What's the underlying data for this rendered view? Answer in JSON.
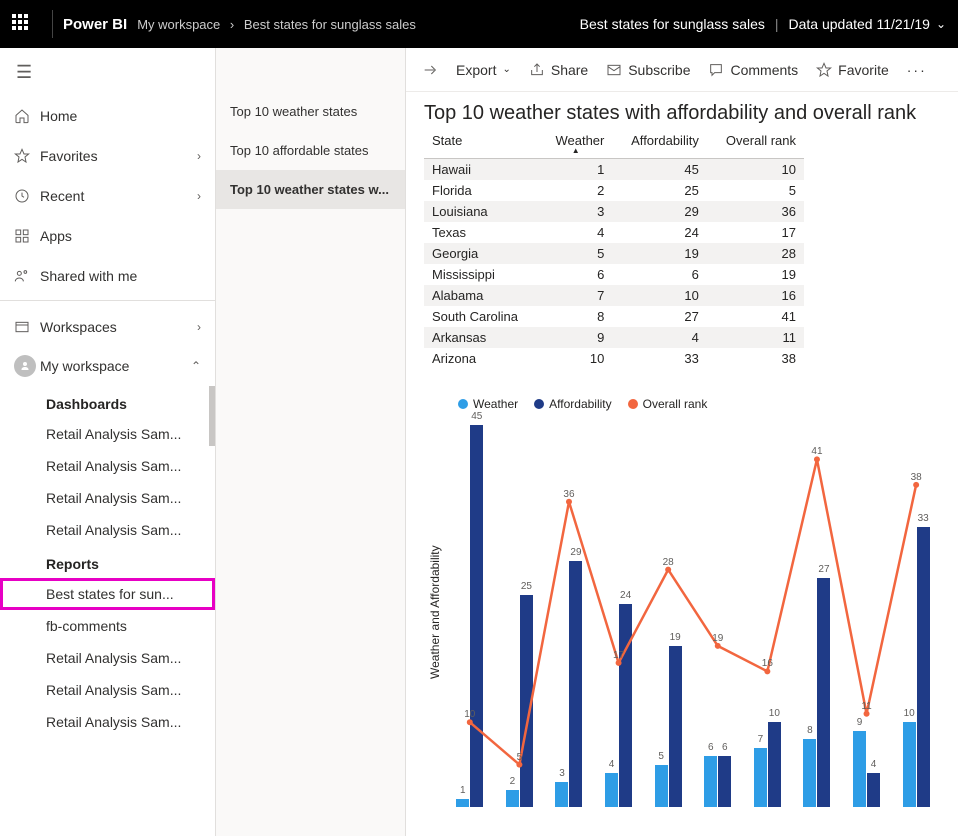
{
  "header": {
    "brand": "Power BI",
    "breadcrumb": [
      "My workspace",
      "Best states for sunglass sales"
    ],
    "right_title": "Best states for sunglass sales",
    "updated": "Data updated 11/21/19"
  },
  "nav": {
    "home": "Home",
    "favorites": "Favorites",
    "recent": "Recent",
    "apps": "Apps",
    "shared": "Shared with me",
    "workspaces": "Workspaces",
    "my_workspace": "My workspace",
    "dashboards_label": "Dashboards",
    "dashboards": [
      "Retail Analysis Sam...",
      "Retail Analysis Sam...",
      "Retail Analysis Sam...",
      "Retail Analysis Sam..."
    ],
    "reports_label": "Reports",
    "reports": [
      "Best states for sun...",
      "fb-comments",
      "Retail Analysis Sam...",
      "Retail Analysis Sam...",
      "Retail Analysis Sam..."
    ]
  },
  "pages": {
    "items": [
      "Top 10 weather states",
      "Top 10 affordable states",
      "Top 10 weather states w..."
    ],
    "active_index": 2
  },
  "toolbar": {
    "export": "Export",
    "share": "Share",
    "subscribe": "Subscribe",
    "comments": "Comments",
    "favorite": "Favorite"
  },
  "report": {
    "title": "Top 10 weather states with affordability and overall rank",
    "columns": [
      "State",
      "Weather",
      "Affordability",
      "Overall rank"
    ],
    "rows": [
      {
        "state": "Hawaii",
        "weather": 1,
        "afford": 45,
        "rank": 10
      },
      {
        "state": "Florida",
        "weather": 2,
        "afford": 25,
        "rank": 5
      },
      {
        "state": "Louisiana",
        "weather": 3,
        "afford": 29,
        "rank": 36
      },
      {
        "state": "Texas",
        "weather": 4,
        "afford": 24,
        "rank": 17
      },
      {
        "state": "Georgia",
        "weather": 5,
        "afford": 19,
        "rank": 28
      },
      {
        "state": "Mississippi",
        "weather": 6,
        "afford": 6,
        "rank": 19
      },
      {
        "state": "Alabama",
        "weather": 7,
        "afford": 10,
        "rank": 16
      },
      {
        "state": "South Carolina",
        "weather": 8,
        "afford": 27,
        "rank": 41
      },
      {
        "state": "Arkansas",
        "weather": 9,
        "afford": 4,
        "rank": 11
      },
      {
        "state": "Arizona",
        "weather": 10,
        "afford": 33,
        "rank": 38
      }
    ]
  },
  "chart_data": {
    "type": "bar+line",
    "title": "",
    "ylabel": "Weather and Affordability",
    "ylim": [
      0,
      46
    ],
    "categories": [
      "Hawaii",
      "Florida",
      "Louisiana",
      "Texas",
      "Georgia",
      "Mississippi",
      "Alabama",
      "South Carolina",
      "Arkansas",
      "Arizona"
    ],
    "series": [
      {
        "name": "Weather",
        "type": "bar",
        "color": "#2E9DE6",
        "values": [
          1,
          2,
          3,
          4,
          5,
          6,
          7,
          8,
          9,
          10
        ]
      },
      {
        "name": "Affordability",
        "type": "bar",
        "color": "#1F3B87",
        "values": [
          45,
          25,
          29,
          24,
          19,
          6,
          10,
          27,
          4,
          33
        ]
      },
      {
        "name": "Overall rank",
        "type": "line",
        "color": "#F2663F",
        "values": [
          10,
          5,
          36,
          17,
          28,
          19,
          16,
          41,
          11,
          38
        ]
      }
    ],
    "legend": [
      "Weather",
      "Affordability",
      "Overall rank"
    ]
  },
  "colors": {
    "weather": "#2E9DE6",
    "afford": "#1F3B87",
    "rank": "#F2663F"
  }
}
